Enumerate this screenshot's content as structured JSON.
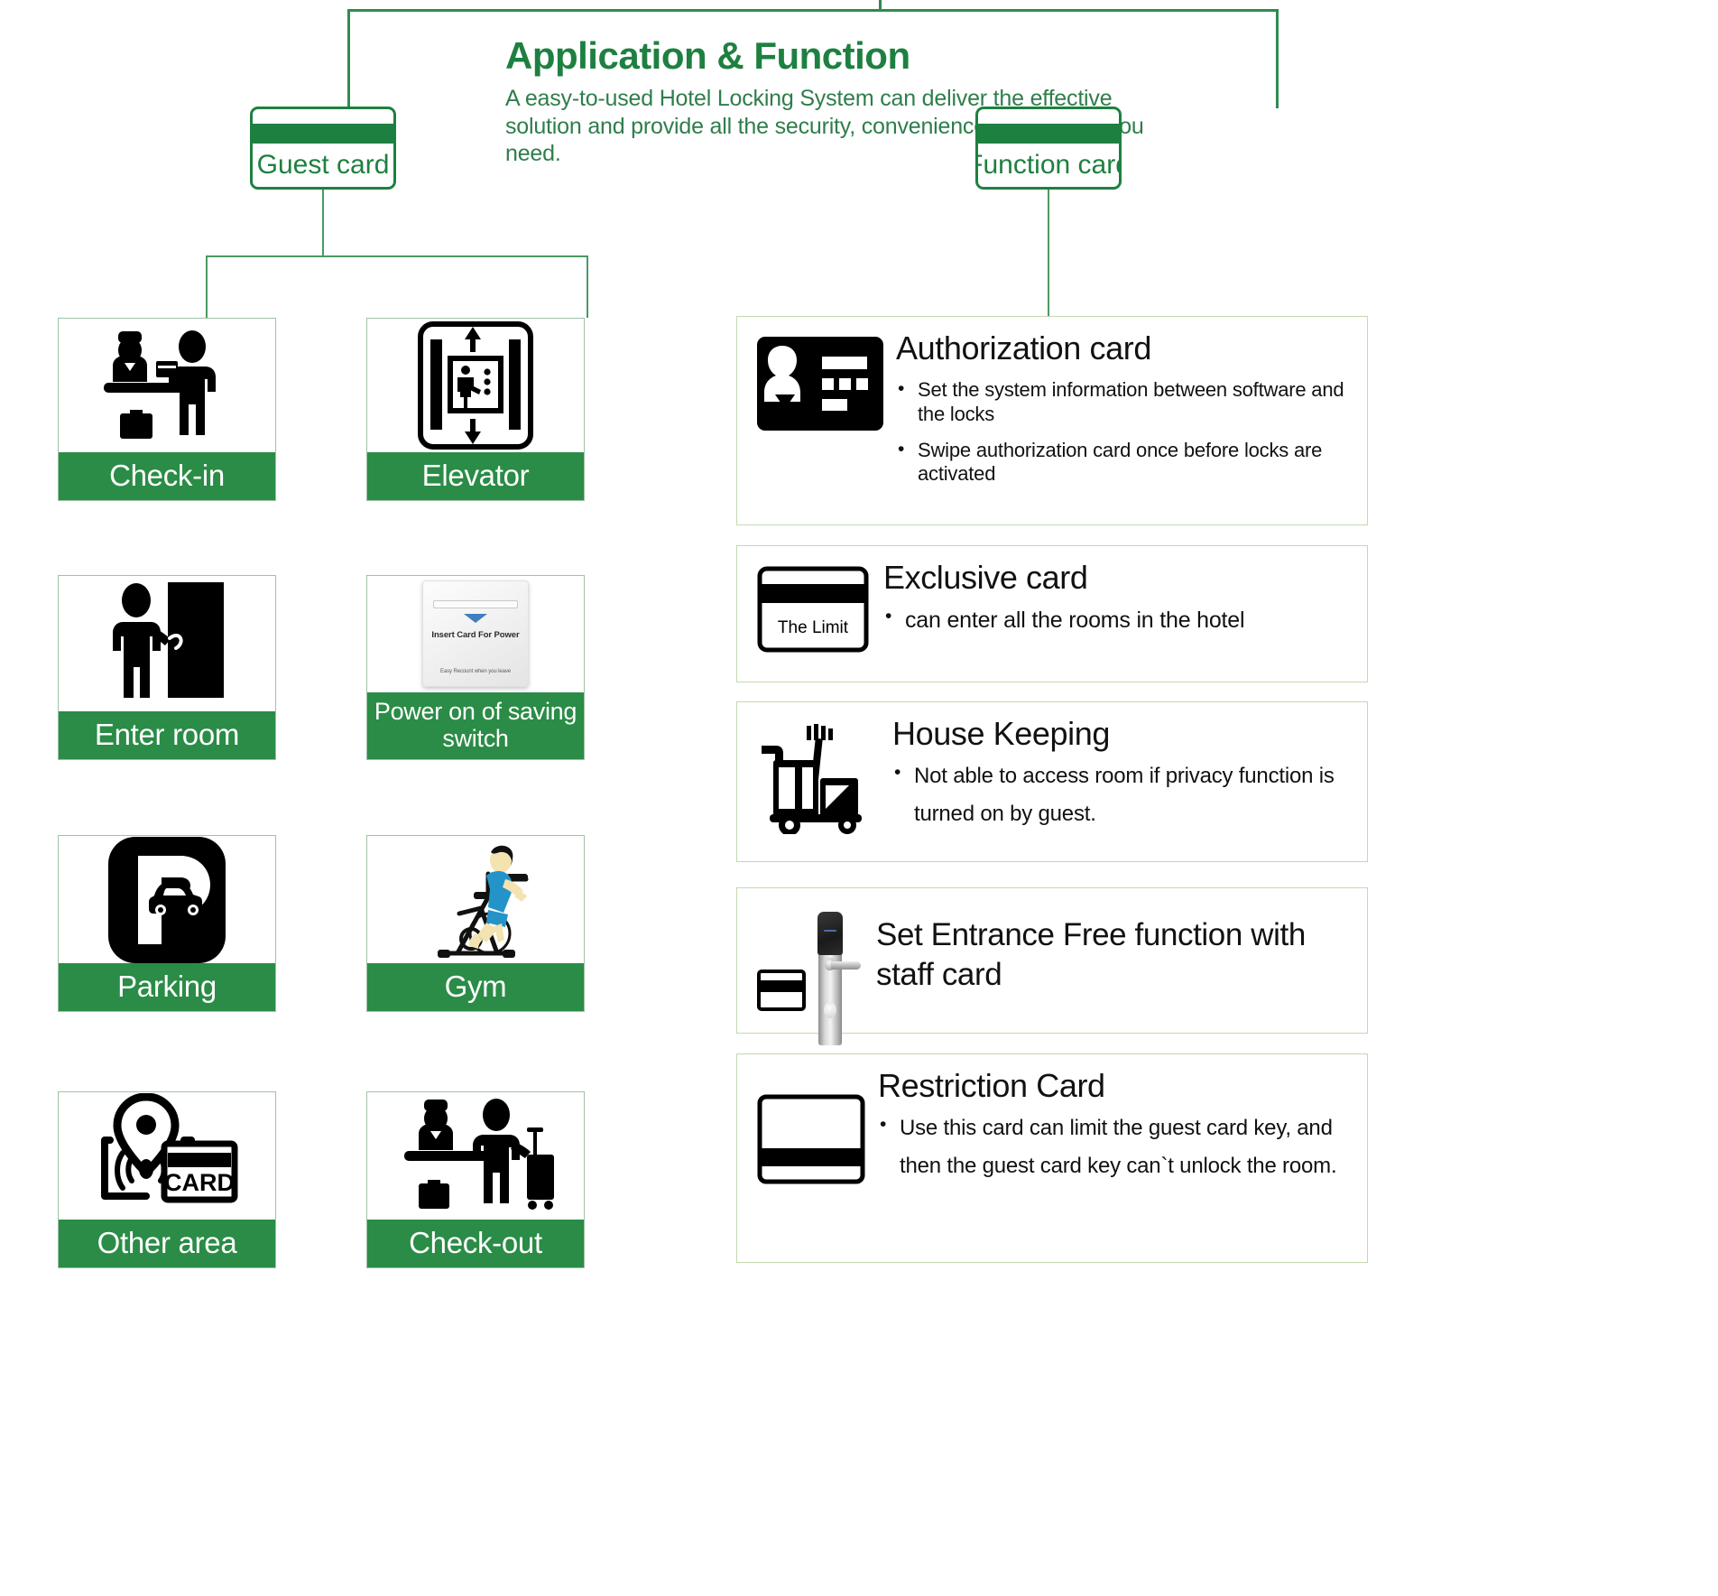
{
  "header": {
    "title": "Application & Function",
    "description": "A easy-to-used Hotel Locking System can deliver the effective solution and provide all the security, convenience and control you need."
  },
  "nodes": {
    "guest_card": "Guest card",
    "function_card": "Function card"
  },
  "applications": [
    {
      "label": "Check-in",
      "icon": "reception-checkin-icon"
    },
    {
      "label": "Elevator",
      "icon": "elevator-icon"
    },
    {
      "label": "Enter room",
      "icon": "person-door-icon"
    },
    {
      "label": "Power on of saving switch",
      "icon": "energy-saving-switch-icon",
      "switch_line1": "Insert Card For Power",
      "switch_line2": "Easy Recount when you leave"
    },
    {
      "label": "Parking",
      "icon": "parking-car-icon"
    },
    {
      "label": "Gym",
      "icon": "spin-bike-icon"
    },
    {
      "label": "Other area",
      "icon": "location-card-reader-icon",
      "card_text": "CARD"
    },
    {
      "label": "Check-out",
      "icon": "reception-checkout-icon"
    }
  ],
  "functions": [
    {
      "title": "Authorization card",
      "icon": "id-badge-card-icon",
      "bullets": [
        "Set the system information between software and the locks",
        "Swipe authorization card once before locks are activated"
      ]
    },
    {
      "title": "Exclusive card",
      "icon": "magnetic-stripe-card-icon",
      "card_label": "The Limit",
      "bullets": [
        "can enter all the rooms in the hotel"
      ]
    },
    {
      "title": "House Keeping",
      "icon": "housekeeping-cart-icon",
      "bullets": [
        "Not able to access room if privacy function is turned on by guest."
      ]
    },
    {
      "title": "Set Entrance Free function with staff card",
      "icon": "door-lock-card-icon",
      "bullets": []
    },
    {
      "title": "Restriction Card",
      "icon": "blank-stripe-card-icon",
      "bullets": [
        "Use this card can limit the guest card key, and then the guest card key can`t unlock the room."
      ]
    }
  ],
  "colors": {
    "brand_green": "#1e8040",
    "tile_green": "#2a8c46",
    "panel_border": "#c3d9af",
    "tile_border": "#9dc3a6"
  }
}
